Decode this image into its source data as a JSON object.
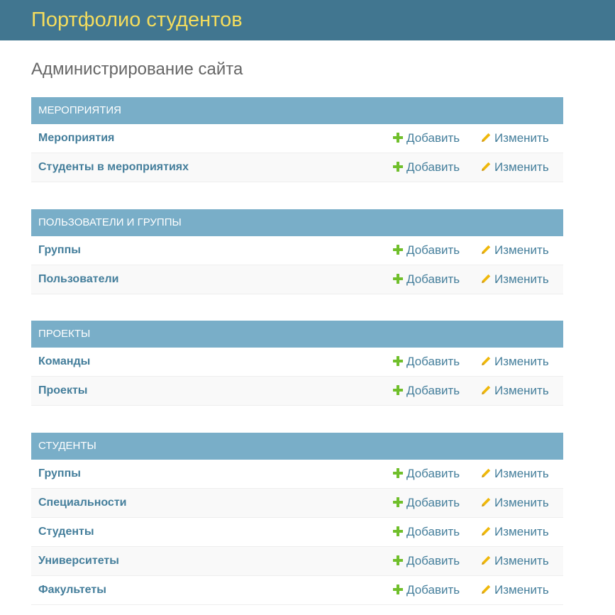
{
  "header": {
    "site_title": "Портфолио студентов"
  },
  "page": {
    "title": "Администрирование сайта"
  },
  "actions": {
    "add_label": "Добавить",
    "change_label": "Изменить",
    "add_icon": "plus-icon",
    "change_icon": "pencil-icon"
  },
  "colors": {
    "header_bg": "#417690",
    "site_title": "#f5dd5d",
    "caption_bg": "#79aec8",
    "link": "#447e9b",
    "add_icon": "#70bf2b",
    "change_icon": "#efb80b"
  },
  "modules": [
    {
      "caption": "Мероприятия",
      "models": [
        {
          "label": "Мероприятия"
        },
        {
          "label": "Студенты в мероприятиях"
        }
      ]
    },
    {
      "caption": "Пользователи и группы",
      "models": [
        {
          "label": "Группы"
        },
        {
          "label": "Пользователи"
        }
      ]
    },
    {
      "caption": "Проекты",
      "models": [
        {
          "label": "Команды"
        },
        {
          "label": "Проекты"
        }
      ]
    },
    {
      "caption": "Студенты",
      "models": [
        {
          "label": "Группы"
        },
        {
          "label": "Специальности"
        },
        {
          "label": "Студенты"
        },
        {
          "label": "Университеты"
        },
        {
          "label": "Факультеты"
        }
      ]
    }
  ]
}
